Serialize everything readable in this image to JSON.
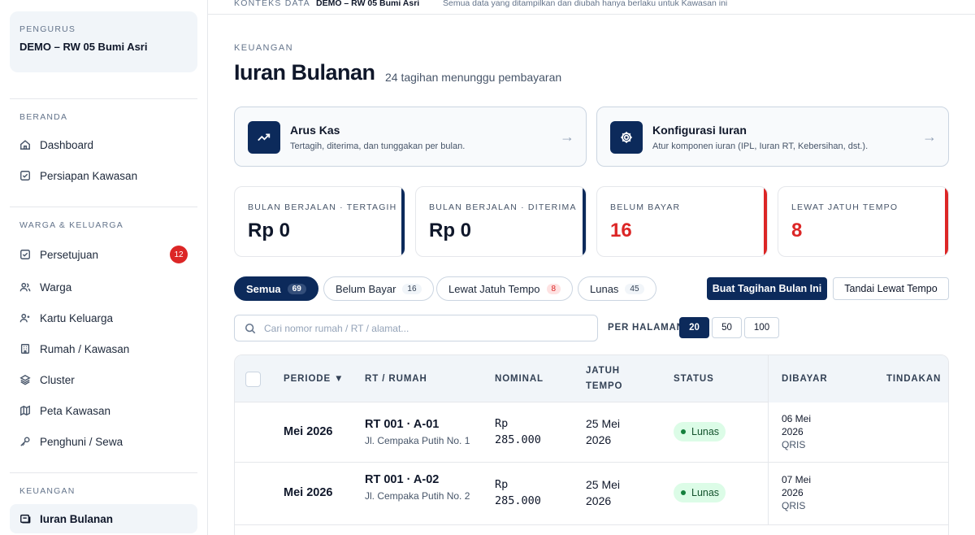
{
  "sidebar": {
    "org_label": "PENGURUS",
    "org_name": "DEMO – RW 05 Bumi Asri",
    "sections": {
      "beranda": "BERANDA",
      "warga": "WARGA & KELUARGA",
      "keuangan": "KEUANGAN"
    },
    "items": [
      {
        "label": "Dashboard",
        "icon": "home-icon"
      },
      {
        "label": "Persiapan Kawasan",
        "icon": "checkbox-icon"
      },
      {
        "label": "Persetujuan",
        "icon": "checkbox-icon",
        "badge": "12"
      },
      {
        "label": "Warga",
        "icon": "users-icon"
      },
      {
        "label": "Kartu Keluarga",
        "icon": "user-group-icon"
      },
      {
        "label": "Rumah / Kawasan",
        "icon": "building-icon"
      },
      {
        "label": "Cluster",
        "icon": "layers-icon"
      },
      {
        "label": "Peta Kawasan",
        "icon": "map-icon"
      },
      {
        "label": "Penghuni / Sewa",
        "icon": "key-icon"
      },
      {
        "label": "Iuran Bulanan",
        "icon": "receipt-icon",
        "active": true
      }
    ]
  },
  "context": {
    "label": "KONTEKS DATA",
    "value": "DEMO – RW 05 Bumi Asri",
    "note": "Semua data yang ditampilkan dan diubah hanya berlaku untuk Kawasan ini"
  },
  "header": {
    "kicker": "KEUANGAN",
    "title": "Iuran Bulanan",
    "subtitle": "24 tagihan menunggu pembayaran"
  },
  "quick_links": [
    {
      "title": "Arus Kas",
      "desc": "Tertagih, diterima, dan tunggakan per bulan.",
      "icon": "trending-up-icon",
      "arrow": "→"
    },
    {
      "title": "Konfigurasi Iuran",
      "desc": "Atur komponen iuran (IPL, Iuran RT, Kebersihan, dst.).",
      "icon": "gear-icon",
      "arrow": "→"
    }
  ],
  "stats": [
    {
      "label": "BULAN BERJALAN · TERTAGIH",
      "value": "Rp 0",
      "accent": "#0c2a5b"
    },
    {
      "label": "BULAN BERJALAN · DITERIMA",
      "value": "Rp 0",
      "accent": "#0c2a5b"
    },
    {
      "label": "BELUM BAYAR",
      "value": "16",
      "accent": "#dc2626"
    },
    {
      "label": "LEWAT JATUH TEMPO",
      "value": "8",
      "accent": "#dc2626"
    }
  ],
  "filters": [
    {
      "label": "Semua",
      "count": "69",
      "active": true
    },
    {
      "label": "Belum Bayar",
      "count": "16"
    },
    {
      "label": "Lewat Jatuh Tempo",
      "count": "8"
    },
    {
      "label": "Lunas",
      "count": "45"
    }
  ],
  "actions": {
    "create": "Buat Tagihan Bulan Ini",
    "mark_overdue": "Tandai Lewat Tempo"
  },
  "search": {
    "placeholder": "Cari nomor rumah / RT / alamat..."
  },
  "per_page": {
    "label": "PER HALAMAN",
    "options": [
      "20",
      "50",
      "100"
    ],
    "selected": "20"
  },
  "table": {
    "columns": {
      "periode": "PERIODE ▼",
      "rt": "RT / RUMAH",
      "nominal": "NOMINAL",
      "jatuh_tempo_1": "JATUH",
      "jatuh_tempo_2": "TEMPO",
      "status": "STATUS",
      "dibayar": "DIBAYAR",
      "tindakan": "TINDAKAN"
    },
    "rows": [
      {
        "periode": "Mei 2026",
        "rt": "RT 001 · A-01",
        "alamat": "Jl. Cempaka Putih No. 1",
        "nominal_1": "Rp",
        "nominal_2": "285.000",
        "due_1": "25 Mei",
        "due_2": "2026",
        "status": "Lunas",
        "paid_1": "06 Mei",
        "paid_2": "2026",
        "method": "QRIS"
      },
      {
        "periode": "Mei 2026",
        "rt": "RT 001 · A-02",
        "alamat": "Jl. Cempaka Putih No. 2",
        "nominal_1": "Rp",
        "nominal_2": "285.000",
        "due_1": "25 Mei",
        "due_2": "2026",
        "status": "Lunas",
        "paid_1": "07 Mei",
        "paid_2": "2026",
        "method": "QRIS"
      }
    ]
  }
}
